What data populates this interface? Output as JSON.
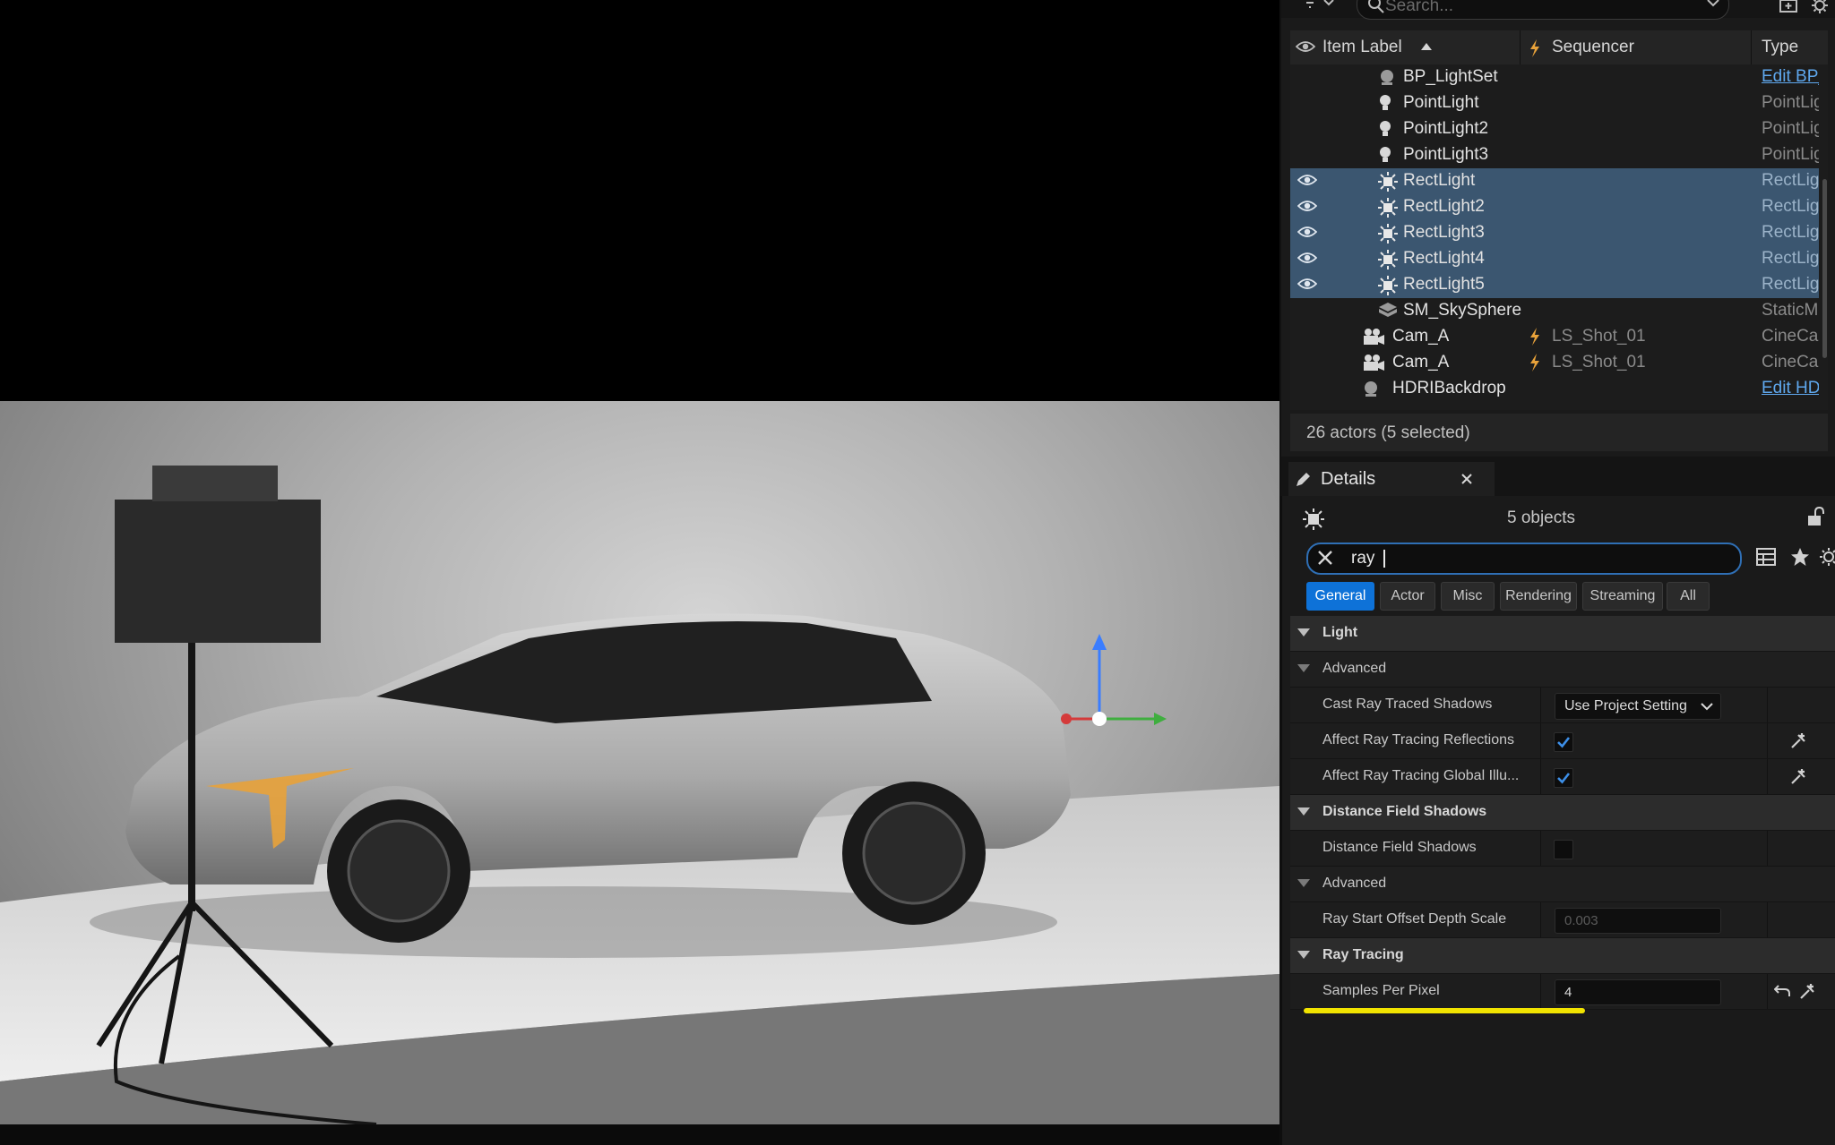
{
  "outliner": {
    "search_placeholder": "Search...",
    "columns": {
      "item_label": "Item Label",
      "sequencer": "Sequencer",
      "type": "Type"
    },
    "rows": [
      {
        "label": "BP_LightSet",
        "type": "Edit BP_I",
        "icon": "blueprint-icon",
        "indent": 2,
        "selected": false,
        "type_link": true,
        "sequencer": ""
      },
      {
        "label": "PointLight",
        "type": "PointLigh",
        "icon": "point-light-icon",
        "indent": 2,
        "selected": false,
        "type_link": false,
        "sequencer": ""
      },
      {
        "label": "PointLight2",
        "type": "PointLigh",
        "icon": "point-light-icon",
        "indent": 2,
        "selected": false,
        "type_link": false,
        "sequencer": ""
      },
      {
        "label": "PointLight3",
        "type": "PointLigh",
        "icon": "point-light-icon",
        "indent": 2,
        "selected": false,
        "type_link": false,
        "sequencer": ""
      },
      {
        "label": "RectLight",
        "type": "RectLigh",
        "icon": "rect-light-icon",
        "indent": 2,
        "selected": true,
        "type_link": false,
        "sequencer": ""
      },
      {
        "label": "RectLight2",
        "type": "RectLigh",
        "icon": "rect-light-icon",
        "indent": 2,
        "selected": true,
        "type_link": false,
        "sequencer": ""
      },
      {
        "label": "RectLight3",
        "type": "RectLigh",
        "icon": "rect-light-icon",
        "indent": 2,
        "selected": true,
        "type_link": false,
        "sequencer": ""
      },
      {
        "label": "RectLight4",
        "type": "RectLigh",
        "icon": "rect-light-icon",
        "indent": 2,
        "selected": true,
        "type_link": false,
        "sequencer": ""
      },
      {
        "label": "RectLight5",
        "type": "RectLigh",
        "icon": "rect-light-icon",
        "indent": 2,
        "selected": true,
        "type_link": false,
        "sequencer": ""
      },
      {
        "label": "SM_SkySphere",
        "type": "StaticMe",
        "icon": "static-mesh-icon",
        "indent": 2,
        "selected": false,
        "type_link": false,
        "sequencer": ""
      },
      {
        "label": "Cam_A",
        "type": "CineCam",
        "icon": "camera-icon",
        "indent": 1,
        "selected": false,
        "type_link": false,
        "sequencer": "LS_Shot_01"
      },
      {
        "label": "Cam_A",
        "type": "CineCam",
        "icon": "camera-icon",
        "indent": 1,
        "selected": false,
        "type_link": false,
        "sequencer": "LS_Shot_01"
      },
      {
        "label": "HDRIBackdrop",
        "type": "Edit HDR",
        "icon": "blueprint-icon",
        "indent": 1,
        "selected": false,
        "type_link": true,
        "sequencer": ""
      }
    ],
    "status": "26 actors (5 selected)"
  },
  "details": {
    "tab_title": "Details",
    "objects_label": "5 objects",
    "filter_value": "ray",
    "categories": [
      {
        "label": "General",
        "active": true
      },
      {
        "label": "Actor",
        "active": false
      },
      {
        "label": "Misc",
        "active": false
      },
      {
        "label": "Rendering",
        "active": false
      },
      {
        "label": "Streaming",
        "active": false
      },
      {
        "label": "All",
        "active": false
      }
    ],
    "sections": {
      "light": "Light",
      "light_advanced": "Advanced",
      "distance_field_shadows": "Distance Field Shadows",
      "dfs_advanced": "Advanced",
      "ray_tracing": "Ray Tracing"
    },
    "properties": {
      "cast_ray_traced_shadows": {
        "label": "Cast Ray Traced Shadows",
        "value": "Use Project Setting"
      },
      "affect_rt_reflections": {
        "label": "Affect Ray Tracing Reflections",
        "checked": true
      },
      "affect_rt_gi": {
        "label": "Affect Ray Tracing Global Illu...",
        "checked": true
      },
      "distance_field_shadows": {
        "label": "Distance Field Shadows",
        "checked": false
      },
      "ray_start_offset": {
        "label": "Ray Start Offset Depth Scale",
        "value": "0.003"
      },
      "samples_per_pixel": {
        "label": "Samples Per Pixel",
        "value": "4"
      }
    }
  },
  "colors": {
    "selection": "#3b5670",
    "accent": "#0e72d8",
    "highlight_underline": "#f1e300",
    "sequencer_bolt": "#e8a23a",
    "link": "#5fa8ee"
  }
}
